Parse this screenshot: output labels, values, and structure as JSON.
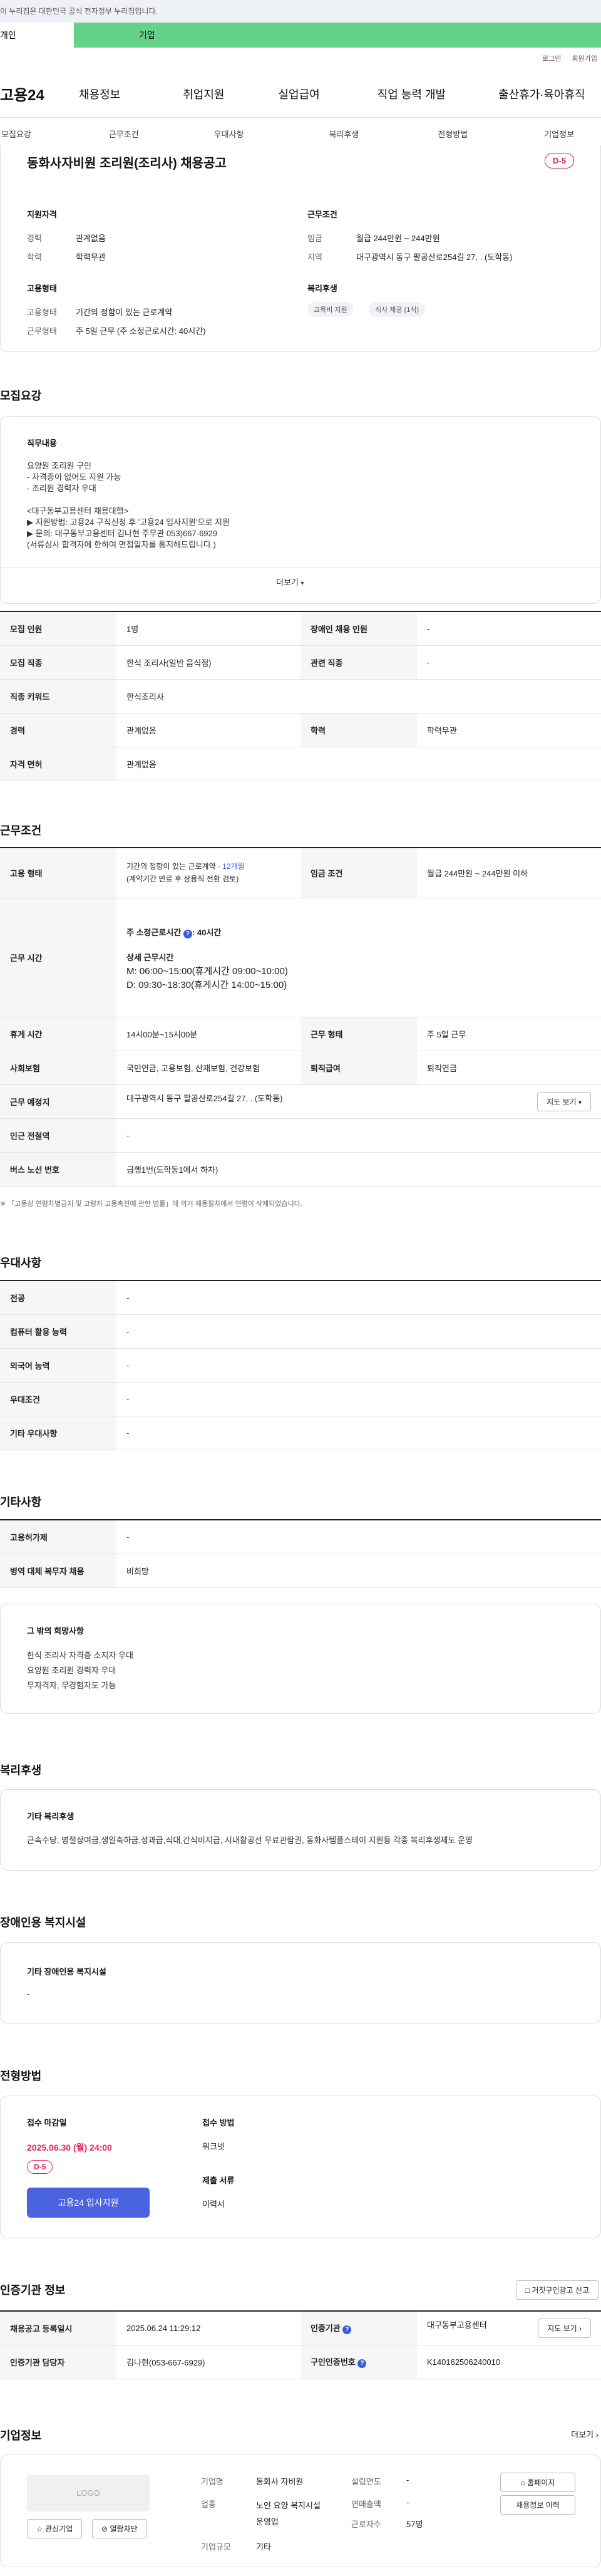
{
  "gov_banner": "이 누리집은 대한민국 공식 전자정부 누리집입니다.",
  "top_tabs": {
    "personal": "개인",
    "corp": "기업"
  },
  "util": [
    "로그인",
    "회원가입"
  ],
  "logo": "고용24",
  "gnb": [
    "채용정보",
    "취업지원",
    "실업급여",
    "직업 능력 개발",
    "출산휴가·육아휴직"
  ],
  "subnav": [
    "모집요강",
    "근무조건",
    "우대사항",
    "복리후생",
    "전형방법",
    "기업정보"
  ],
  "job": {
    "title": "동화사자비원 조리원(조리사) 채용공고",
    "dday": "D-5",
    "summary": {
      "qual_title": "지원자격",
      "career_k": "경력",
      "career_v": "관계없음",
      "edu_k": "학력",
      "edu_v": "학력무관",
      "emp_title": "고용형태",
      "etype_k": "고용형태",
      "etype_v": "기간의 정함이 있는 근로계약",
      "wtype_k": "근무형태",
      "wtype_v": "주 5일 근무 (주 소정근로시간: 40시간)",
      "cond_title": "근무조건",
      "wage_k": "임금",
      "wage_v": "월급 244만원 ~ 244만원",
      "region_k": "지역",
      "region_v": "대구광역시 동구 팔공산로254길 27, . (도학동)",
      "welfare_title": "복리후생",
      "welfare_tags": [
        "교육비 지원",
        "식사 제공 (1식)"
      ]
    }
  },
  "recruit": {
    "heading": "모집요강",
    "duty_title": "직무내용",
    "duty_lines": [
      "요양원 조리원 구인",
      "- 자격증이 없어도 지원 가능",
      "- 조리원 경력자 우대",
      "",
      "<대구동부고용센터 채용대행>",
      "▶ 지원방법: 고용24 구직신청 후 '고용24 입사지원'으로 지원",
      "▶ 문의: 대구동부고용센터 김나현 주무관 053)667-6929",
      "(서류심사 합격자에 한하여 면접일자를 통지해드립니다.)"
    ],
    "more": "더보기",
    "rows": [
      [
        "모집 인원",
        "1명",
        "장애인 채용 인원",
        "-"
      ],
      [
        "모집 직종",
        "한식 조리사(일반 음식점)",
        "관련 직종",
        "-"
      ],
      [
        "직종 키워드",
        "한식조리사"
      ],
      [
        "경력",
        "관계없음",
        "학력",
        "학력무관"
      ],
      [
        "자격 면허",
        "관계없음"
      ]
    ]
  },
  "conditions": {
    "heading": "근무조건",
    "emp_k": "고용 형태",
    "emp_v1": "기간의 정함이 있는 근로계약 · ",
    "emp_v1b": "12개월",
    "emp_v2": "(계약기간 만료 후 상용직 전환 검토)",
    "wage_k": "임금 조건",
    "wage_v": "월급 244만원 ~ 244만원 이하",
    "time_k": "근무 시간",
    "time_total": "주 소정근로시간",
    "time_total_v": ": 40시간",
    "time_detail_title": "상세 근무시간",
    "time_detail": [
      "M: 06:00~15:00(휴게시간 09:00~10:00)",
      "D: 09:30~18:30(휴게시간 14:00~15:00)"
    ],
    "break_k": "휴게 시간",
    "break_v": "14시00분~15시00분",
    "wform_k": "근무 형태",
    "wform_v": "주 5일 근무",
    "ins_k": "사회보험",
    "ins_v": "국민연금, 고용보험, 산재보험, 건강보험",
    "ret_k": "퇴직급여",
    "ret_v": "퇴직연금",
    "place_k": "근무 예정지",
    "place_v": "대구광역시 동구 팔공산로254길 27, . (도학동)",
    "map_btn": "지도 보기",
    "station_k": "인근 전철역",
    "station_v": "-",
    "bus_k": "버스 노선 번호",
    "bus_v": "급행1번(도학동1에서 하차)",
    "note": "※ 「고용상 연령차별금지 및 고령자 고용촉진에 관한 법률」에 의거 채용절차에서 연령이 삭제되었습니다."
  },
  "prefer": {
    "heading": "우대사항",
    "rows": [
      [
        "전공",
        "-"
      ],
      [
        "컴퓨터 활용 능력",
        "-"
      ],
      [
        "외국어 능력",
        "-"
      ],
      [
        "우대조건",
        "-"
      ],
      [
        "기타 우대사항",
        "-"
      ]
    ]
  },
  "etc": {
    "heading": "기타사항",
    "rows": [
      [
        "고용허가제",
        "-"
      ],
      [
        "병역 대체 복무자 채용",
        "비희망"
      ]
    ],
    "box_title": "그 밖의 희망사항",
    "box_lines": [
      "한식 조리사 자격증 소지자 우대",
      "요양원 조리원 경력자 우대",
      "무자격자, 무경험자도 가능"
    ]
  },
  "welfare": {
    "heading": "복리후생",
    "box_title": "기타 복리후생",
    "box_text": "근속수당, 명절상여금,생일축하금,성과급,식대,간식비지급, 시내활공선 무료관람권, 동화사템플스테이 지원등 각종 복리후생제도 운영"
  },
  "disability": {
    "heading": "장애인용 복지시설",
    "box_title": "기타 장애인용 복지시설",
    "box_text": "-"
  },
  "selection": {
    "heading": "전형방법",
    "deadline_k": "접수 마감일",
    "deadline_v": "2025.06.30 (월) 24:00",
    "dday": "D-5",
    "apply_btn": "고용24 입사지원",
    "method_k": "접수 방법",
    "method_v": "워크넷",
    "docs_k": "제출 서류",
    "docs_v": "이력서"
  },
  "cert": {
    "heading": "인증기관 정보",
    "report_btn": "거짓구인광고 신고",
    "rows": [
      [
        "채용공고 등록일시",
        "2025.06.24 11:29:12",
        "인증기관",
        "대구동부고용센터"
      ],
      [
        "인증기관 담당자",
        "김나현(053-667-6929)",
        "구인인증번호",
        "K140162506240010"
      ]
    ],
    "map_btn": "지도 보기"
  },
  "company": {
    "heading": "기업정보",
    "more": "더보기",
    "logo_text": "LOGO",
    "fav_btn": "관심기업",
    "block_btn": "열람차단",
    "name_k": "기업명",
    "name_v": "동화사 자비원",
    "ind_k": "업종",
    "ind_v": "노인 요양 복지시설 운영업",
    "size_k": "기업규모",
    "size_v": "기타",
    "year_k": "설립연도",
    "year_v": "-",
    "sales_k": "연매출액",
    "sales_v": "-",
    "emp_k": "근로자수",
    "emp_v": "57명",
    "home_btn": "홈페이지",
    "jobs_btn": "채용정보 이력"
  }
}
